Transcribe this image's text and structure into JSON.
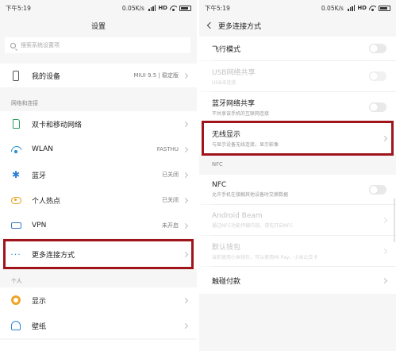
{
  "left": {
    "status": {
      "time": "下午5:19",
      "net": "0.05K/s",
      "hd": "HD"
    },
    "title": "设置",
    "search": {
      "placeholder": "搜索系统设置项"
    },
    "device": {
      "label": "我的设备",
      "value": "MIUI 9.5 | 稳定版"
    },
    "section_network": "网络和连接",
    "network_items": [
      {
        "label": "双卡和移动网络",
        "value": "",
        "icon": "sim-card-icon"
      },
      {
        "label": "WLAN",
        "value": "FASTHU",
        "icon": "wifi-icon"
      },
      {
        "label": "蓝牙",
        "value": "已关闭",
        "icon": "bluetooth-icon"
      },
      {
        "label": "个人热点",
        "value": "已关闭",
        "icon": "hotspot-icon"
      },
      {
        "label": "VPN",
        "value": "未开启",
        "icon": "vpn-icon"
      },
      {
        "label": "更多连接方式",
        "value": "",
        "icon": "more-dots-icon"
      }
    ],
    "section_personal": "个人",
    "personal_items": [
      {
        "label": "显示",
        "icon": "display-icon"
      },
      {
        "label": "壁纸",
        "icon": "wallpaper-icon"
      }
    ]
  },
  "right": {
    "status": {
      "time": "下午5:19",
      "net": "0.05K/s",
      "hd": "HD"
    },
    "title": "更多连接方式",
    "items": [
      {
        "title": "飞行模式",
        "sub": ""
      },
      {
        "title": "USB网络共享",
        "sub": "USB未连接"
      },
      {
        "title": "蓝牙网络共享",
        "sub": "不共享该手机的互联网连接"
      },
      {
        "title": "无线显示",
        "sub": "与显示设备无线连接，显示影像"
      }
    ],
    "section_nfc": "NFC",
    "nfc_items": [
      {
        "title": "NFC",
        "sub": "允许手机在接触其他设备时交换数据"
      },
      {
        "title": "Android Beam",
        "sub": "通过NFC功能传输内容，请先开启NFC"
      },
      {
        "title": "默认钱包",
        "sub": "当前使用小米钱包，可以使用Mi Pay、小米公交卡"
      },
      {
        "title": "触碰付款",
        "sub": ""
      }
    ]
  },
  "colors": {
    "highlight": "#a0141c",
    "accent_blue": "#2a8fd6",
    "background": "#f6f6f6"
  }
}
